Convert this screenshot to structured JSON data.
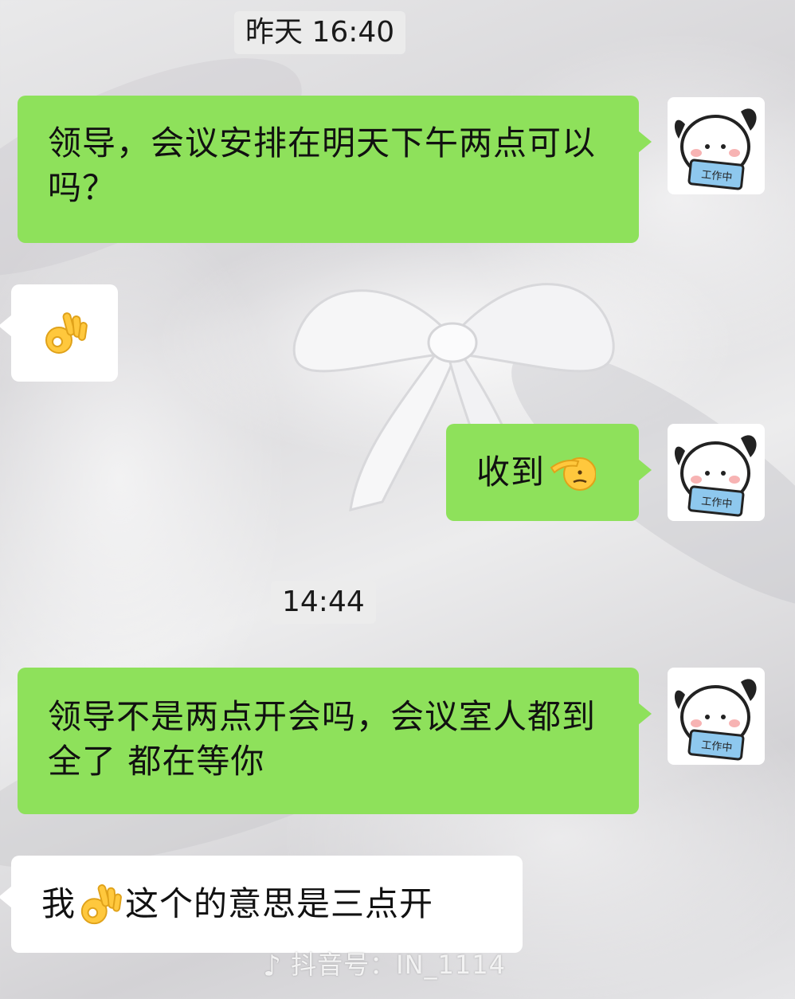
{
  "chat": {
    "time_1": "昨天 16:40",
    "time_2": "14:44",
    "msg1": "领导，会议安排在明天下午两点可以吗？",
    "msg2_icon": "ok-hand-emoji",
    "msg3_text": "收到",
    "msg3_icon": "salute-emoji",
    "msg4": "领导不是两点开会吗，会议室人都到全了 都在等你",
    "msg5_before": "我",
    "msg5_icon": "ok-hand-emoji",
    "msg5_after": "这个的意思是三点开"
  },
  "avatar": {
    "sign_text": "工作中",
    "icon": "puppy-avatar"
  },
  "watermark": {
    "icon": "douyin-logo-icon",
    "text": "抖音号：IN_1114"
  },
  "colors": {
    "sent_bubble": "#8ee15b",
    "received_bubble": "#ffffff",
    "background": "#e2e1e4"
  }
}
